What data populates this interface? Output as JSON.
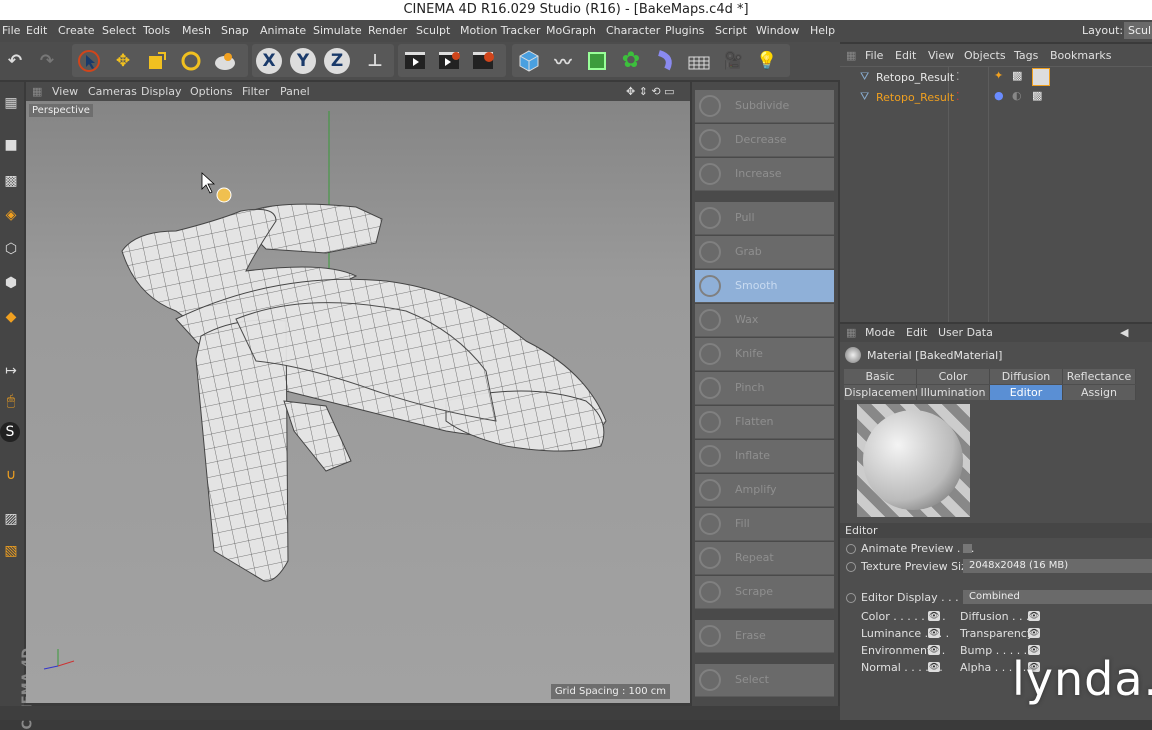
{
  "window": {
    "title": "CINEMA 4D R16.029 Studio (R16) - [BakeMaps.c4d *]"
  },
  "menubar": {
    "items": [
      "File",
      "Edit",
      "Create",
      "Select",
      "Tools",
      "Mesh",
      "Snap",
      "Animate",
      "Simulate",
      "Render",
      "Sculpt",
      "Motion Tracker",
      "MoGraph",
      "Character",
      "Plugins",
      "Script",
      "Window",
      "Help"
    ],
    "layout_label": "Layout:",
    "layout_value": "Sculp"
  },
  "toolbar": {
    "axis_x": "X",
    "axis_y": "Y",
    "axis_z": "Z"
  },
  "viewport": {
    "menu": [
      "View",
      "Cameras",
      "Display",
      "Options",
      "Filter",
      "Panel"
    ],
    "label": "Perspective",
    "grid_spacing": "Grid Spacing : 100 cm",
    "bg_color": "#9a9a9a"
  },
  "sculpt_tools": {
    "items": [
      "Subdivide",
      "Decrease",
      "Increase",
      "Pull",
      "Grab",
      "Smooth",
      "Wax",
      "Knife",
      "Pinch",
      "Flatten",
      "Inflate",
      "Amplify",
      "Fill",
      "Repeat",
      "Scrape",
      "Erase",
      "Select"
    ],
    "active": "Smooth",
    "active_color": "#8fb0d8"
  },
  "object_manager": {
    "menu": [
      "File",
      "Edit",
      "View",
      "Objects",
      "Tags",
      "Bookmarks"
    ],
    "objects": [
      {
        "name": "Retopo_Result",
        "color": "#e8e8e8"
      },
      {
        "name": "Retopo_Result",
        "color": "#f0a020"
      }
    ]
  },
  "attribute_manager": {
    "menu": [
      "Mode",
      "Edit",
      "User Data"
    ],
    "title": "Material [BakedMaterial]",
    "tabs_row1": [
      "Basic",
      "Color",
      "Diffusion",
      "Reflectance"
    ],
    "tabs_row2": [
      "Displacement",
      "Illumination",
      "Editor",
      "Assign"
    ],
    "active_tab": "Editor",
    "section": "Editor",
    "animate_preview_label": "Animate Preview . . .",
    "texture_preview_label": "Texture Preview Size",
    "texture_preview_value": "2048x2048 (16 MB)",
    "editor_display_label": "Editor Display . . . . . .",
    "editor_display_value": "Combined",
    "channels_left": [
      "Color . . . . . . . .",
      "Luminance . . . .",
      "Environment . .",
      "Normal . . . . . ."
    ],
    "channels_right": [
      "Diffusion . . . .",
      "Transparency",
      "Bump . . . . . . .",
      "Alpha . . . . . ."
    ],
    "accent": "#5a8fd4"
  },
  "watermark": {
    "text": "lynda.c"
  },
  "icons": [
    "undo-icon",
    "redo-icon",
    "live-selection-icon",
    "move-icon",
    "scale-icon",
    "rotate-icon",
    "recent-tool-icon",
    "lock-x-icon",
    "lock-y-icon",
    "lock-z-icon",
    "world-coordinates-icon",
    "render-view-icon",
    "render-picture-viewer-icon",
    "render-settings-icon",
    "cube-icon",
    "pen-icon",
    "subdivision-icon",
    "cloner-icon",
    "deformer-icon",
    "floor-icon",
    "camera-icon",
    "light-icon"
  ]
}
